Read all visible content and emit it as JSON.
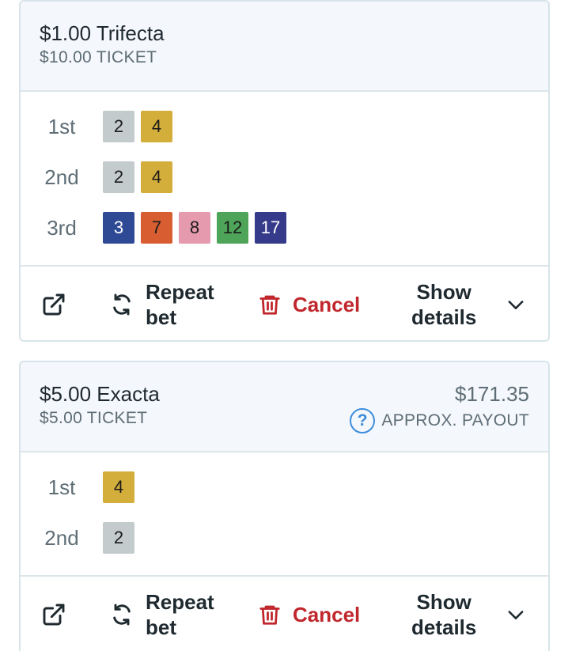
{
  "bets": [
    {
      "title": "$1.00 Trifecta",
      "ticket": "$10.00 TICKET",
      "picks": [
        {
          "label": "1st",
          "runners": [
            {
              "num": "2",
              "color": "#c3cbcd"
            },
            {
              "num": "4",
              "color": "#d4ae3a"
            }
          ]
        },
        {
          "label": "2nd",
          "runners": [
            {
              "num": "2",
              "color": "#c3cbcd"
            },
            {
              "num": "4",
              "color": "#d4ae3a"
            }
          ]
        },
        {
          "label": "3rd",
          "runners": [
            {
              "num": "3",
              "color": "#2e4a95"
            },
            {
              "num": "7",
              "color": "#d85e32"
            },
            {
              "num": "8",
              "color": "#e59aae"
            },
            {
              "num": "12",
              "color": "#4ea55a"
            },
            {
              "num": "17",
              "color": "#353a8a"
            }
          ]
        }
      ],
      "actions": {
        "share_icon": "external-link-icon",
        "repeat_line1": "Repeat",
        "repeat_line2": "bet",
        "cancel": "Cancel",
        "details_line1": "Show",
        "details_line2": "details"
      }
    },
    {
      "title": "$5.00 Exacta",
      "ticket": "$5.00 TICKET",
      "payout_amount": "$171.35",
      "payout_label": "APPROX. PAYOUT",
      "help_glyph": "?",
      "picks": [
        {
          "label": "1st",
          "runners": [
            {
              "num": "4",
              "color": "#d4ae3a"
            }
          ]
        },
        {
          "label": "2nd",
          "runners": [
            {
              "num": "2",
              "color": "#c3cbcd"
            }
          ]
        }
      ],
      "actions": {
        "share_icon": "external-link-icon",
        "repeat_line1": "Repeat",
        "repeat_line2": "bet",
        "cancel": "Cancel",
        "details_line1": "Show",
        "details_line2": "details"
      }
    }
  ],
  "colors": {
    "cancel_red": "#c0272d",
    "help_blue": "#3d8ddb",
    "header_bg": "#f4f7fb"
  }
}
